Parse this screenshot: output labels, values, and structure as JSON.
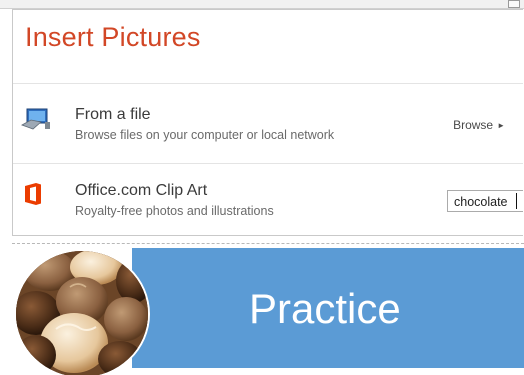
{
  "dialog": {
    "title": "Insert Pictures",
    "from_file": {
      "title": "From a file",
      "subtitle": "Browse files on your computer or local network",
      "action_label": "Browse",
      "action_icon": "triangle-right-icon",
      "icon": "computer-monitor-icon"
    },
    "clip_art": {
      "title": "Office.com Clip Art",
      "subtitle": "Royalty-free photos and illustrations",
      "search_value": "chocolate",
      "icon": "office-logo-icon"
    }
  },
  "slide": {
    "title": "Practice",
    "image": "chocolate-truffles-photo"
  },
  "colors": {
    "title_accent": "#d24726",
    "office_logo": "#eb3c00",
    "banner": "#5b9bd5"
  }
}
